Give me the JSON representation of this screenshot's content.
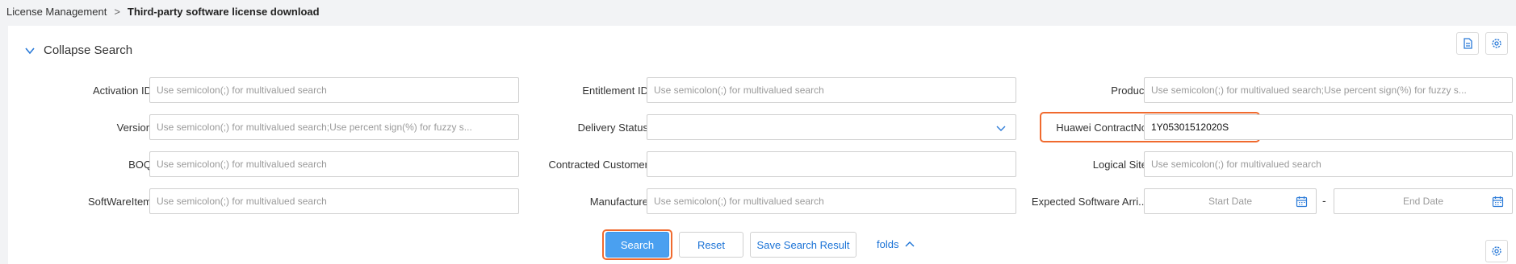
{
  "breadcrumb": {
    "parent": "License Management",
    "separator": ">",
    "current": "Third-party software license download"
  },
  "search_panel": {
    "collapse_label": "Collapse Search"
  },
  "fields": {
    "activation_id": {
      "label": "Activation ID",
      "placeholder": "Use semicolon(;) for multivalued search"
    },
    "entitlement_id": {
      "label": "Entitlement ID",
      "placeholder": "Use semicolon(;) for multivalued search"
    },
    "product": {
      "label": "Product",
      "placeholder": "Use semicolon(;) for multivalued search;Use percent sign(%) for fuzzy s..."
    },
    "version": {
      "label": "Version",
      "placeholder": "Use semicolon(;) for multivalued search;Use percent sign(%) for fuzzy s..."
    },
    "delivery_status": {
      "label": "Delivery Status",
      "value": ""
    },
    "huawei_contract_no": {
      "label": "Huawei ContractNo",
      "value": "1Y05301512020S"
    },
    "boq": {
      "label": "BOQ",
      "placeholder": "Use semicolon(;) for multivalued search"
    },
    "contracted_customer": {
      "label": "Contracted Customer",
      "value": ""
    },
    "logical_site": {
      "label": "Logical Site",
      "placeholder": "Use semicolon(;) for multivalued search"
    },
    "software_item": {
      "label": "SoftWareItem",
      "placeholder": "Use semicolon(;) for multivalued search"
    },
    "manufacture": {
      "label": "Manufacture",
      "placeholder": "Use semicolon(;) for multivalued search"
    },
    "expected_arrival": {
      "label": "Expected Software Arri...",
      "start_placeholder": "Start Date",
      "separator": "-",
      "end_placeholder": "End Date"
    }
  },
  "actions": {
    "search": "Search",
    "reset": "Reset",
    "save_search_result": "Save Search Result",
    "folds": "folds"
  },
  "colors": {
    "primary": "#4aa0f0",
    "link": "#1a72d6",
    "highlight": "#f06a2e"
  },
  "icons": [
    "chevron-down-icon",
    "document-icon",
    "settings-icon",
    "calendar-icon",
    "chevron-up-icon"
  ]
}
